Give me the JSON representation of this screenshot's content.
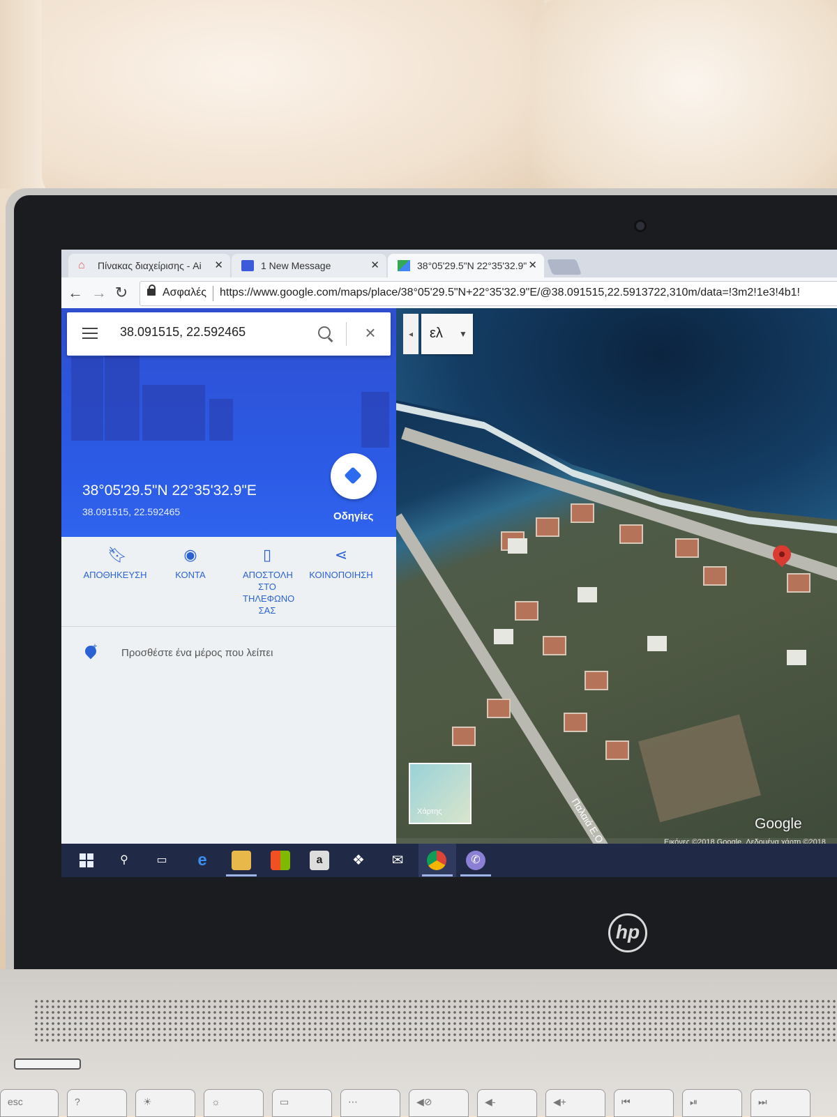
{
  "browser": {
    "tabs": [
      {
        "label": "Πίνακας διαχείρισης - Ai"
      },
      {
        "label": "1 New Message"
      },
      {
        "label": "38°05'29.5\"N 22°35'32.9\""
      }
    ],
    "close_glyph": "✕",
    "secure_label": "Ασφαλές",
    "url": "https://www.google.com/maps/place/38°05'29.5\"N+22°35'32.9\"E/@38.091515,22.5913722,310m/data=!3m2!1e3!4b1!"
  },
  "maps": {
    "search_value": "38.091515, 22.592465",
    "place_title": "38°05'29.5\"N 22°35'32.9\"E",
    "place_subtitle": "38.091515, 22.592465",
    "directions_label": "Οδηγίες",
    "actions": [
      {
        "label": "ΑΠΟΘΗΚΕΥΣΗ",
        "icon": "bookmark-icon"
      },
      {
        "label": "ΚΟΝΤΑ",
        "icon": "nearby-pin-icon"
      },
      {
        "label": "ΑΠΟΣΤΟΛΗ ΣΤΟ ΤΗΛΕΦΩΝΟ ΣΑΣ",
        "icon": "send-to-phone-icon"
      },
      {
        "label": "ΚΟΙΝΟΠΟΙΗΣΗ",
        "icon": "share-icon"
      }
    ],
    "add_place": "Προσθέστε ένα μέρος που λείπει",
    "language_label": "ελ",
    "minimap_label": "Χάρτης",
    "google_logo": "Google",
    "street_label": "Παλαιά Ε.Ο. Κο",
    "copyright": "Εικόνες ©2018 Google, Δεδομένα χάρτη ©2018"
  },
  "laptop": {
    "brand": "hp",
    "keys": [
      "esc",
      "?",
      "☀",
      "☼",
      "▭",
      "⋯",
      "◀⊘",
      "◀-",
      "◀+",
      "⏮",
      "⏯",
      "⏭"
    ]
  },
  "colors": {
    "maps_blue": "#2c5be6",
    "map_pin": "#d93a32",
    "taskbar": "#202a46"
  }
}
